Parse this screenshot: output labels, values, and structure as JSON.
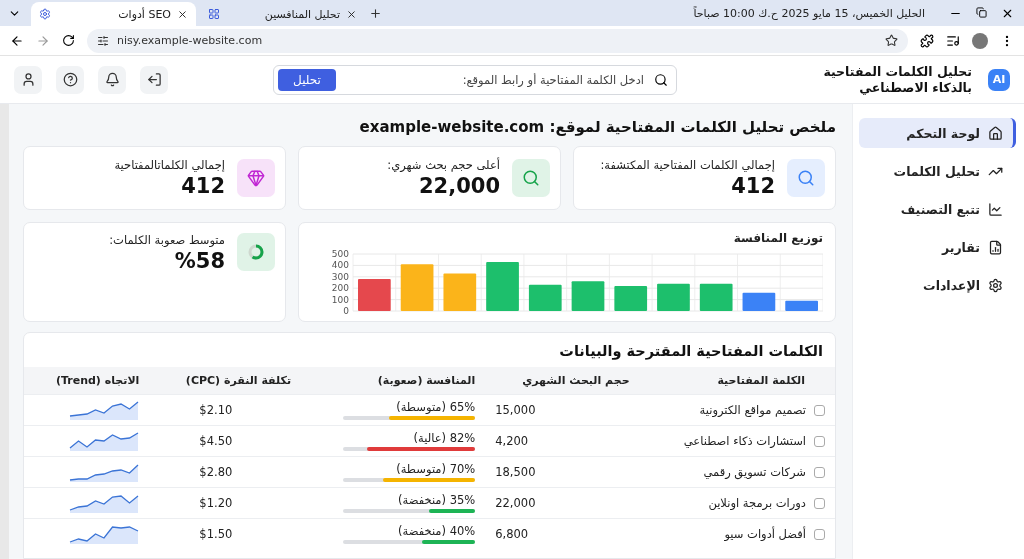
{
  "browser": {
    "tabs": [
      {
        "title": "تحليل المنافسين",
        "selected": false
      },
      {
        "title": "أدوات SEO",
        "selected": true
      }
    ],
    "window_title": "الحليل الخميس، 15 مايو 2025 ح.ك 10:00 صباحاً",
    "url": "nisy.example-website.com"
  },
  "app": {
    "logo": "AI",
    "title": "تحليل الكلمات المفتاحية بالذكاء الاصطناعي",
    "search": {
      "placeholder": "ادخل الكلمة المفتاحية أو رابط الموقع:",
      "button": "تحليل"
    }
  },
  "sidebar": {
    "items": [
      {
        "label": "لوحة التحكم",
        "selected": true
      },
      {
        "label": "تحليل الكلمات",
        "selected": false
      },
      {
        "label": "تتبع التصنيف",
        "selected": false
      },
      {
        "label": "تقارير",
        "selected": false
      },
      {
        "label": "الإعدادات",
        "selected": false
      }
    ]
  },
  "summary": {
    "title": "ملخص تحليل الكلمات المفتاحية لموقع: example-website.com",
    "stats": [
      {
        "label": "إجمالي الكلمات المفتاحية المكتشفة:",
        "value": "412",
        "color": "#3b82f6"
      },
      {
        "label": "أعلى حجم بحث شهري:",
        "value": "22,000",
        "color": "#16a34a"
      },
      {
        "label": "إجمالي الكلماتالمفتاحية",
        "value": "412",
        "color": "#c026d3"
      }
    ],
    "difficulty": {
      "label": "متوسط صعوبة الكلمات:",
      "value": "%58",
      "color": "#16a34a"
    },
    "competition": {
      "title": "توزيع المنافسة",
      "chart_data": {
        "type": "bar",
        "grid": true,
        "yticks": [
          0,
          100,
          200,
          300,
          400,
          500
        ],
        "ylim": [
          0,
          500
        ],
        "series": [
          {
            "color": "#e5484d",
            "values": [
              280,
              null,
              null,
              null,
              null,
              null,
              null,
              null,
              null,
              null,
              null
            ]
          },
          {
            "color": "#fbb41a",
            "values": [
              null,
              410,
              330,
              null,
              null,
              null,
              null,
              null,
              null,
              null,
              null
            ]
          },
          {
            "color": "#1dbf6c",
            "values": [
              null,
              null,
              null,
              430,
              230,
              260,
              220,
              240,
              240,
              null,
              null
            ]
          },
          {
            "color": "#3b82f6",
            "values": [
              null,
              null,
              null,
              null,
              null,
              null,
              null,
              null,
              null,
              160,
              90
            ]
          }
        ]
      }
    }
  },
  "keywords": {
    "title": "الكلمات المفتاحية المقترحة والبيانات",
    "columns": [
      "الكلمة المفتاحية",
      "حجم البحث الشهري",
      "المنافسة (صعوبة)",
      "تكلفة النقرة (CPC)",
      "الاتجاه (Trend)"
    ],
    "rows": [
      {
        "keyword": "تصميم مواقع الكترونية",
        "checked": false,
        "volume": "15,000",
        "competition": "65% (متوسطة)",
        "kind": "medium",
        "level": 0.65,
        "cpc": "$2.10"
      },
      {
        "keyword": "استشارات ذكاء اصطناعي",
        "checked": false,
        "volume": "4,200",
        "competition": "82% (عالية)",
        "kind": "high",
        "level": 0.82,
        "cpc": "$4.50"
      },
      {
        "keyword": "شركات تسويق رقمي",
        "checked": false,
        "volume": "18,500",
        "competition": "70% (متوسطة)",
        "kind": "medium",
        "level": 0.7,
        "cpc": "$2.80"
      },
      {
        "keyword": "دورات برمجة اونلاين",
        "checked": false,
        "volume": "22,000",
        "competition": "35% (منخفضة)",
        "kind": "low",
        "level": 0.35,
        "cpc": "$1.20"
      },
      {
        "keyword": "أفضل أدوات سيو",
        "checked": false,
        "volume": "6,800",
        "competition": "40% (منخفضة)",
        "kind": "low",
        "level": 0.4,
        "cpc": "$1.50"
      }
    ]
  }
}
